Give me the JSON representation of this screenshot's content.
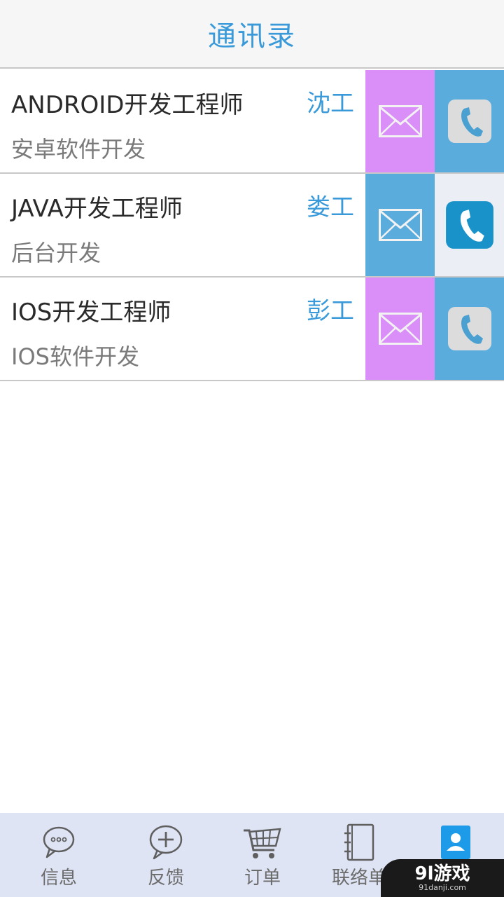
{
  "header": {
    "title": "通讯录"
  },
  "contacts": [
    {
      "title": "ANDROID开发工程师",
      "subtitle": "安卓软件开发",
      "name": "沈工",
      "mail_bg": "#da8ff8",
      "call_bg": "#5aacdc",
      "call_style": "light"
    },
    {
      "title": "JAVA开发工程师",
      "subtitle": "后台开发",
      "name": "娄工",
      "mail_bg": "#5aacdc",
      "call_bg": "#eceef5",
      "call_style": "dark"
    },
    {
      "title": "IOS开发工程师",
      "subtitle": "IOS软件开发",
      "name": "彭工",
      "mail_bg": "#da8ff8",
      "call_bg": "#5aacdc",
      "call_style": "light"
    }
  ],
  "tabs": [
    {
      "label": "信息",
      "icon": "chat-bubble-icon"
    },
    {
      "label": "反馈",
      "icon": "plus-bubble-icon"
    },
    {
      "label": "订单",
      "icon": "cart-icon"
    },
    {
      "label": "联络单",
      "icon": "notebook-icon"
    },
    {
      "label": "",
      "icon": "contacts-icon",
      "active": true
    }
  ],
  "watermark": {
    "main": "9l游戏",
    "sub": "91danji.com"
  },
  "colors": {
    "accent": "#3a9ad9",
    "mail_pink": "#da8ff8",
    "call_blue": "#5aacdc",
    "tab_active": "#1e9be8"
  }
}
